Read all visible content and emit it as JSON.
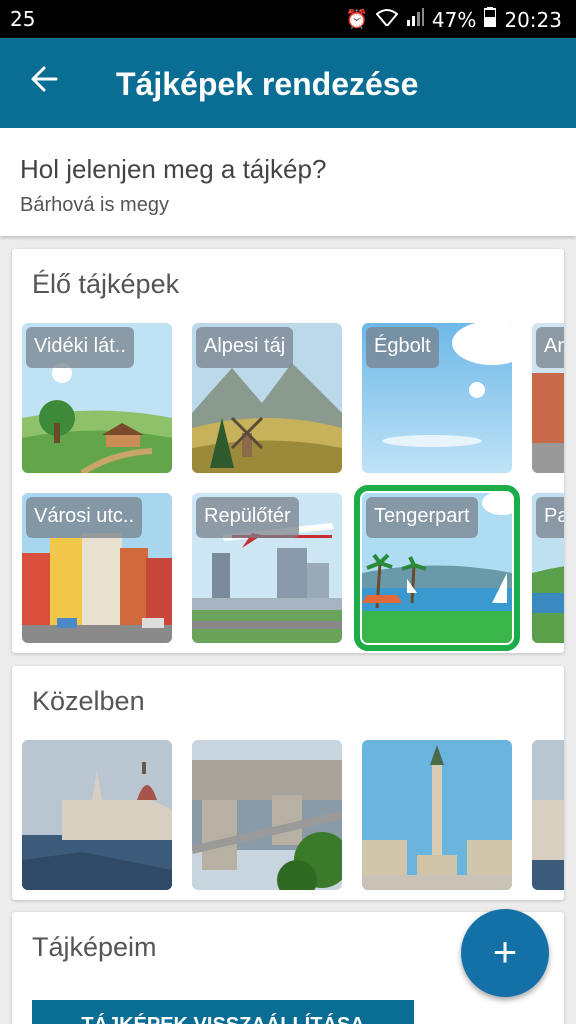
{
  "status_bar": {
    "notification": "25",
    "battery": "47%",
    "time": "20:23",
    "icons": [
      "alarm-icon",
      "wifi-icon",
      "signal-icon",
      "battery-icon"
    ]
  },
  "app_bar": {
    "back_icon": "arrow-left-icon",
    "title": "Tájképek rendezése"
  },
  "location": {
    "question": "Hol jelenjen meg a tájkép?",
    "answer": "Bárhová is megy"
  },
  "live_section": {
    "title": "Élő tájképek",
    "tiles": [
      {
        "label": "Vidéki lát..",
        "picture": "countryside"
      },
      {
        "label": "Alpesi táj",
        "picture": "alpine"
      },
      {
        "label": "Égbolt",
        "picture": "sky"
      },
      {
        "label": "An",
        "picture": "town"
      },
      {
        "label": "Városi utc..",
        "picture": "city-street"
      },
      {
        "label": "Repülőtér",
        "picture": "airport"
      },
      {
        "label": "Tengerpart",
        "picture": "seaside",
        "selected": true
      },
      {
        "label": "Pa",
        "picture": "park"
      }
    ]
  },
  "nearby_section": {
    "title": "Közelben",
    "photos": [
      "parliament",
      "chain-bridge",
      "heroes-square",
      "parliament-partial"
    ]
  },
  "my_section": {
    "title": "Tájképeim",
    "button_label": "TÁJKÉPEK VISSZAÁLLÍTÁSA"
  },
  "fab": {
    "label": "+",
    "icon": "plus-icon"
  },
  "colors": {
    "app_bar": "#0a6d93",
    "fab": "#1471a8",
    "selection": "#1cad49"
  }
}
